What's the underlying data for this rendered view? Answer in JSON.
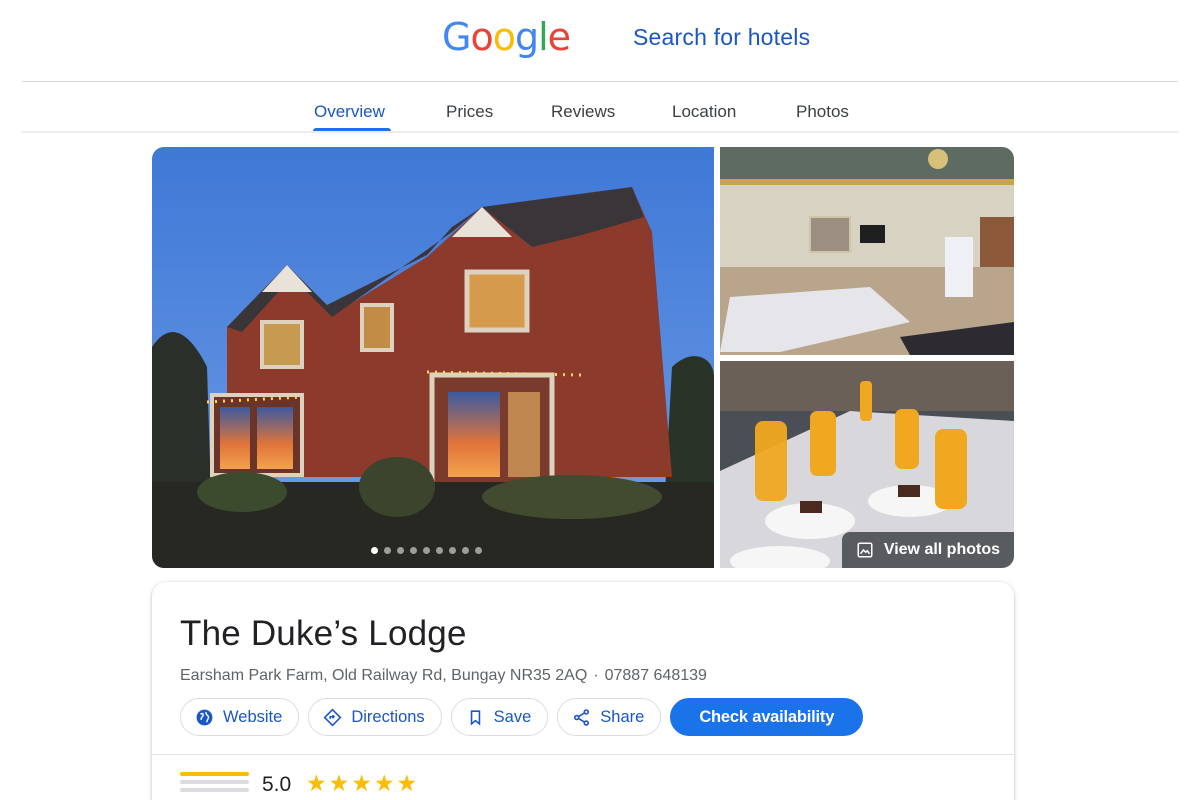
{
  "header": {
    "logo_letters": [
      "G",
      "o",
      "o",
      "g",
      "l",
      "e"
    ],
    "search_title": "Search for hotels"
  },
  "tabs": [
    {
      "label": "Overview",
      "active": true
    },
    {
      "label": "Prices",
      "active": false
    },
    {
      "label": "Reviews",
      "active": false
    },
    {
      "label": "Location",
      "active": false
    },
    {
      "label": "Photos",
      "active": false
    }
  ],
  "gallery": {
    "dot_count": 9,
    "active_dot": 0,
    "view_all_label": "View all photos"
  },
  "hotel": {
    "name": "The Duke’s Lodge",
    "address": "Earsham Park Farm, Old Railway Rd, Bungay NR35 2AQ",
    "separator": "·",
    "phone": "07887 648139"
  },
  "actions": {
    "website": "Website",
    "directions": "Directions",
    "save": "Save",
    "share": "Share",
    "check_availability": "Check availability"
  },
  "rating": {
    "score": "5.0",
    "stars": 5
  },
  "colors": {
    "accent_blue": "#1a73e8",
    "link_blue": "#1a56c4",
    "star_gold": "#fbbc04"
  }
}
